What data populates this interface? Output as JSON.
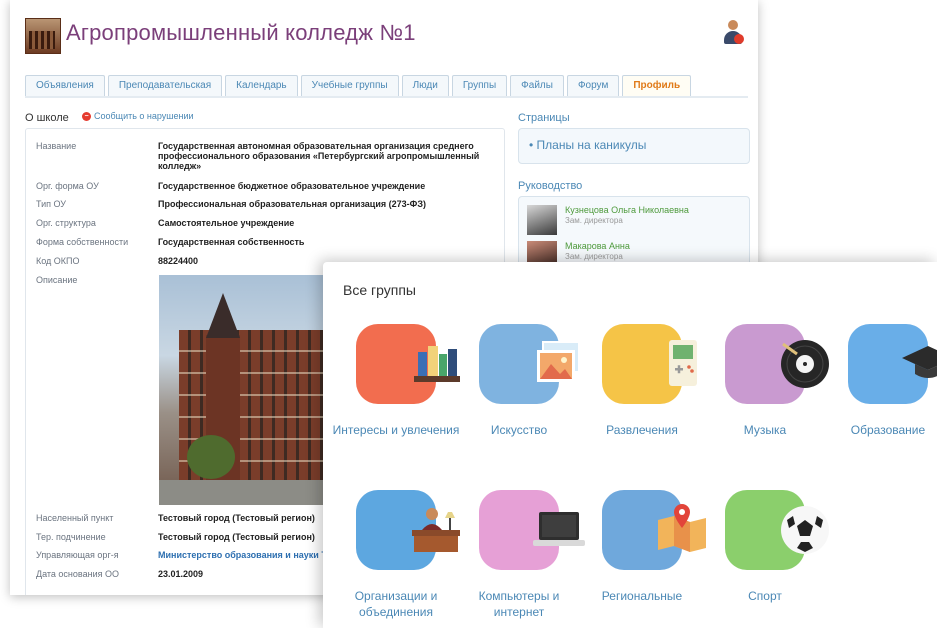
{
  "site": {
    "title": "Агропромышленный колледж №1"
  },
  "tabs": [
    {
      "label": "Объявления"
    },
    {
      "label": "Преподавательская"
    },
    {
      "label": "Календарь"
    },
    {
      "label": "Учебные группы"
    },
    {
      "label": "Люди"
    },
    {
      "label": "Группы"
    },
    {
      "label": "Файлы"
    },
    {
      "label": "Форум"
    },
    {
      "label": "Профиль",
      "active": true
    }
  ],
  "about": {
    "heading": "О школе",
    "report": "Сообщить о нарушении"
  },
  "info": [
    {
      "label": "Название",
      "value": "Государственная автономная образовательная организация среднего профессионального образования «Петербургский агропромышленный колледж»"
    },
    {
      "label": "Орг. форма ОУ",
      "value": "Государственное бюджетное образовательное учреждение"
    },
    {
      "label": "Тип ОУ",
      "value": "Профессиональная образовательная организация (273-ФЗ)"
    },
    {
      "label": "Орг. структура",
      "value": "Самостоятельное учреждение"
    },
    {
      "label": "Форма собственности",
      "value": "Государственная собственность"
    },
    {
      "label": "Код ОКПО",
      "value": "88224400"
    },
    {
      "label": "Описание",
      "value": ""
    },
    {
      "label": "Населенный пункт",
      "value": "Тестовый город (Тестовый регион)"
    },
    {
      "label": "Тер. подчинение",
      "value": "Тестовый город (Тестовый регион)"
    },
    {
      "label": "Управляющая орг-я",
      "value": "Министерство образования и науки Те"
    },
    {
      "label": "Дата основания ОО",
      "value": "23.01.2009"
    }
  ],
  "sidebar": {
    "pages_heading": "Страницы",
    "pages": [
      {
        "label": "Планы на каникулы"
      }
    ],
    "lead_heading": "Руководство",
    "people": [
      {
        "name": "Кузнецова Ольга Николаевна",
        "role": "Зам. директора"
      },
      {
        "name": "Макарова Анна",
        "role": "Зам. директора"
      }
    ]
  },
  "groups": {
    "title": "Все группы",
    "categories": [
      {
        "label": "Интересы и увлечения",
        "icon": "books-icon",
        "color": "#f26d4f"
      },
      {
        "label": "Искусство",
        "icon": "picture-icon",
        "color": "#7fb3e0"
      },
      {
        "label": "Развлечения",
        "icon": "gamepad-icon",
        "color": "#f5c447"
      },
      {
        "label": "Музыка",
        "icon": "vinyl-record-icon",
        "color": "#c99ad0"
      },
      {
        "label": "Образование",
        "icon": "graduation-cap-icon",
        "color": "#69aee8"
      },
      {
        "label": "Организации и объединения",
        "icon": "office-desk-icon",
        "color": "#5da7e0"
      },
      {
        "label": "Компьютеры и интернет",
        "icon": "laptop-icon",
        "color": "#e6a0d6"
      },
      {
        "label": "Региональные",
        "icon": "map-pin-icon",
        "color": "#6fa8dc"
      },
      {
        "label": "Спорт",
        "icon": "soccer-ball-icon",
        "color": "#8bcf6c"
      }
    ]
  }
}
